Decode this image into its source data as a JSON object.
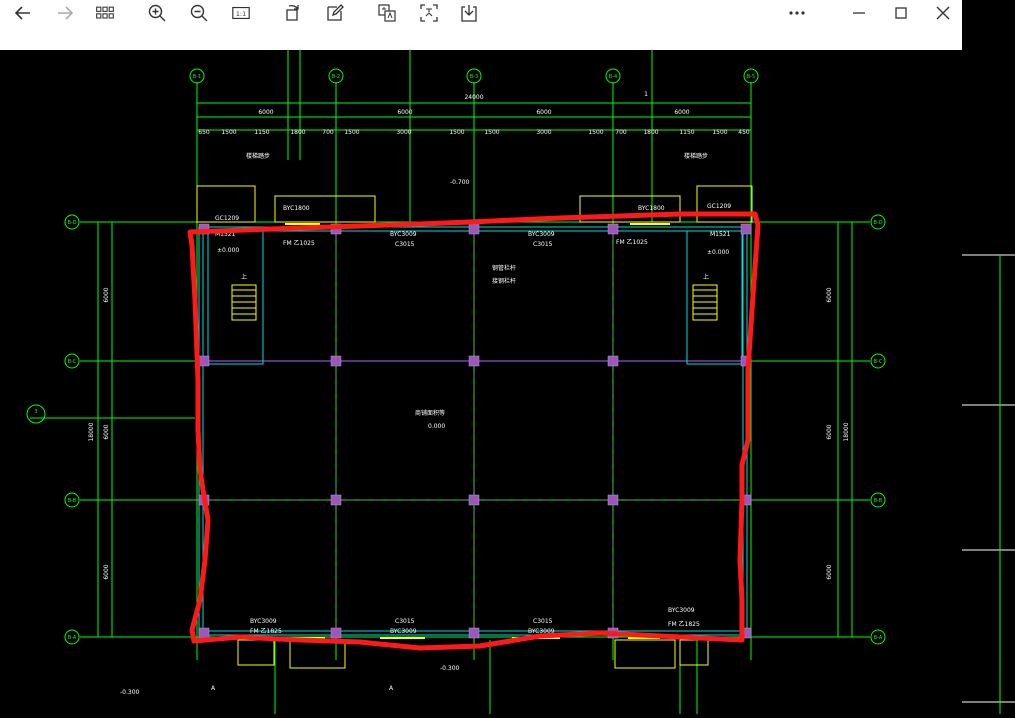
{
  "toolbar": {
    "back_icon": "arrow-left-icon",
    "forward_icon": "arrow-right-icon",
    "grid_icon": "grid-icon",
    "zoom_in_icon": "zoom-in-icon",
    "zoom_out_icon": "zoom-out-icon",
    "actual_size_label": "1:1",
    "rotate_icon": "rotate-icon",
    "edit_icon": "edit-icon",
    "translate_icon": "translate-icon",
    "ocr_icon": "text-recognize-icon",
    "save_icon": "save-icon",
    "more_icon": "more-icon",
    "minimize_icon": "minimize-icon",
    "maximize_icon": "maximize-icon",
    "close_icon": "close-icon"
  },
  "drawing": {
    "axis_top": [
      "B-1",
      "B-2",
      "B-3",
      "B-4",
      "B-5"
    ],
    "axis_side": [
      "B-D",
      "B-C",
      "B-B",
      "B-A"
    ],
    "total_width": "24000",
    "bay_widths": [
      "6000",
      "6000",
      "6000",
      "6000"
    ],
    "detail_dims": [
      "650",
      "1500",
      "1150",
      "1800",
      "700",
      "1500",
      "3000",
      "1500",
      "1500",
      "3000",
      "1500",
      "700",
      "1800",
      "1150",
      "1500",
      "450"
    ],
    "vertical_dims": [
      "6000",
      "6000",
      "6000"
    ],
    "total_height": "18000",
    "room_label": "商铺面积等",
    "room_level": "0.000",
    "labels": {
      "byc_top_left": "BYC1800",
      "gc_top_left": "GC1209",
      "m_top_left": "M1521",
      "fm_top_left": "FM 乙1025",
      "byc_top_mid": "BYC3009",
      "c_top_mid": "C3015",
      "byc_top_mid2": "BYC3009",
      "c_top_mid2": "C3015",
      "byc_top_right": "BYC1800",
      "gc_top_right": "GC1209",
      "m_top_right": "M1521",
      "fm_top_right": "FM 乙1025",
      "note1": "钢管栏杆",
      "note2": "接钢栏杆",
      "stair_up": "上",
      "level_left": "±0.000",
      "level_right": "±0.000",
      "level_top": "-0.700",
      "byc_bot_left": "BYC3009",
      "fm_bot_left": "FM 乙1825",
      "c_bot_mid": "C3015",
      "byc_bot_mid": "BYC3009",
      "c_bot_mid2": "C3015",
      "byc_bot_mid2": "BYC3009",
      "byc_bot_right": "BYC3009",
      "fm_bot_right": "FM 乙1825",
      "section_a": "A",
      "section_a2": "A",
      "level_bottom": "-0.300",
      "level_bottom2": "-0.300",
      "section_mark": "3",
      "stair_label": "楼梯踏步",
      "stair_label2": "楼梯踏步",
      "top_mark": "1"
    }
  }
}
